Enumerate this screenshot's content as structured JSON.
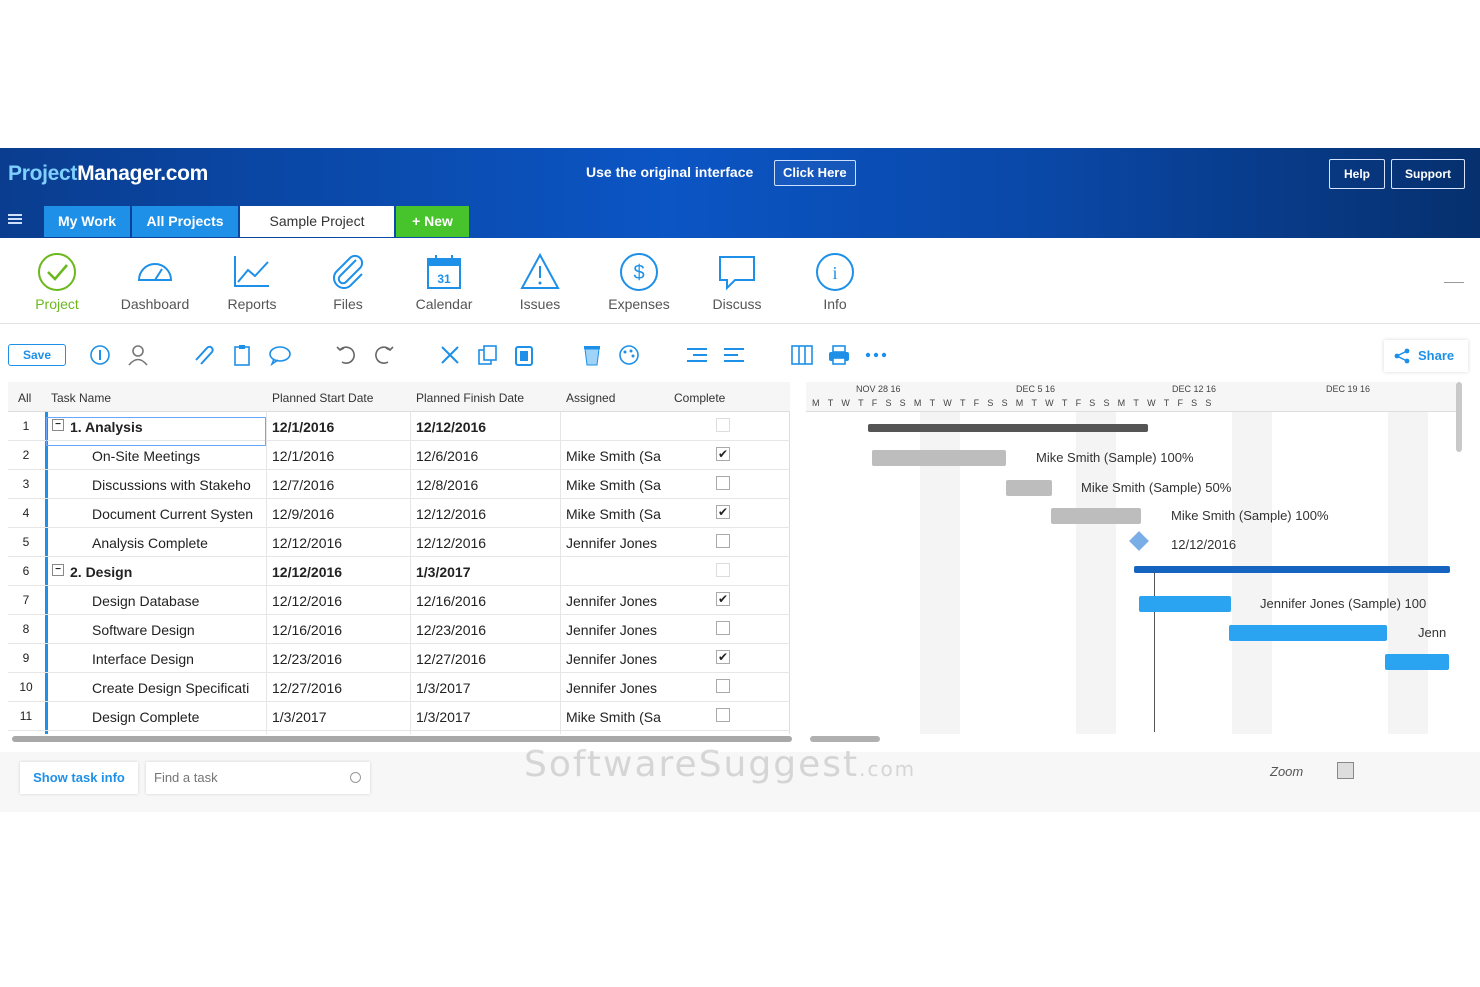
{
  "header": {
    "logo_part1": "Project",
    "logo_part2": "Manager.com",
    "banner_text": "Use the original interface",
    "banner_button": "Click Here",
    "help": "Help",
    "support": "Support"
  },
  "tabs": {
    "my_work": "My Work",
    "all_projects": "All Projects",
    "project": "Sample Project",
    "new": "+ New"
  },
  "modules": [
    {
      "label": "Project",
      "icon": "check-circle-icon"
    },
    {
      "label": "Dashboard",
      "icon": "gauge-icon"
    },
    {
      "label": "Reports",
      "icon": "line-chart-icon"
    },
    {
      "label": "Files",
      "icon": "paperclip-icon"
    },
    {
      "label": "Calendar",
      "icon": "calendar-icon"
    },
    {
      "label": "Issues",
      "icon": "warning-icon"
    },
    {
      "label": "Expenses",
      "icon": "dollar-icon"
    },
    {
      "label": "Discuss",
      "icon": "chat-icon"
    },
    {
      "label": "Info",
      "icon": "info-icon"
    }
  ],
  "toolbar": {
    "save": "Save",
    "share": "Share",
    "colors": {
      "accent": "#1e90e8",
      "new_green": "#47c42b"
    }
  },
  "grid": {
    "headers": {
      "all": "All",
      "name": "Task Name",
      "start": "Planned Start Date",
      "finish": "Planned Finish Date",
      "assigned": "Assigned",
      "complete": "Complete"
    },
    "rows": [
      {
        "n": "1",
        "name": "1. Analysis",
        "start": "12/1/2016",
        "finish": "12/12/2016",
        "assigned": "",
        "checked": "",
        "group": true
      },
      {
        "n": "2",
        "name": "On-Site Meetings",
        "start": "12/1/2016",
        "finish": "12/6/2016",
        "assigned": "Mike Smith (Sa",
        "checked": "✔",
        "group": false
      },
      {
        "n": "3",
        "name": "Discussions with Stakeho",
        "start": "12/7/2016",
        "finish": "12/8/2016",
        "assigned": "Mike Smith (Sa",
        "checked": "",
        "group": false
      },
      {
        "n": "4",
        "name": "Document Current Systen",
        "start": "12/9/2016",
        "finish": "12/12/2016",
        "assigned": "Mike Smith (Sa",
        "checked": "✔",
        "group": false
      },
      {
        "n": "5",
        "name": "Analysis Complete",
        "start": "12/12/2016",
        "finish": "12/12/2016",
        "assigned": "Jennifer Jones",
        "checked": "",
        "group": false
      },
      {
        "n": "6",
        "name": "2. Design",
        "start": "12/12/2016",
        "finish": "1/3/2017",
        "assigned": "",
        "checked": "",
        "group": true
      },
      {
        "n": "7",
        "name": "Design Database",
        "start": "12/12/2016",
        "finish": "12/16/2016",
        "assigned": "Jennifer Jones",
        "checked": "✔",
        "group": false
      },
      {
        "n": "8",
        "name": "Software Design",
        "start": "12/16/2016",
        "finish": "12/23/2016",
        "assigned": "Jennifer Jones",
        "checked": "",
        "group": false
      },
      {
        "n": "9",
        "name": "Interface Design",
        "start": "12/23/2016",
        "finish": "12/27/2016",
        "assigned": "Jennifer Jones",
        "checked": "✔",
        "group": false
      },
      {
        "n": "10",
        "name": "Create Design Specificati",
        "start": "12/27/2016",
        "finish": "1/3/2017",
        "assigned": "Jennifer Jones",
        "checked": "",
        "group": false
      },
      {
        "n": "11",
        "name": "Design Complete",
        "start": "1/3/2017",
        "finish": "1/3/2017",
        "assigned": "Mike Smith (Sa",
        "checked": "",
        "group": false
      }
    ]
  },
  "gantt": {
    "weeks": [
      "NOV 28 16",
      "DEC 5 16",
      "DEC 12 16",
      "DEC 19 16"
    ],
    "days": "MTWTFSSMTWTFSSMTWTFSSMTWTFSS",
    "labels": {
      "r2": "Mike Smith (Sample) 100%",
      "r3": "Mike Smith (Sample) 50%",
      "r4": "Mike Smith (Sample) 100%",
      "r5": "12/12/2016",
      "r7": "Jennifer Jones (Sample) 100",
      "r8": "Jenn"
    },
    "colors": {
      "summary_gray": "#555555",
      "task_gray": "#bdbdbd",
      "task_blue": "#2aa3f0",
      "summary_blue": "#1565c0"
    }
  },
  "footer": {
    "show_task_info": "Show task info",
    "find_placeholder": "Find a task",
    "zoom": "Zoom"
  },
  "watermark": {
    "main": "SoftwareSuggest",
    "suffix": ".com"
  }
}
